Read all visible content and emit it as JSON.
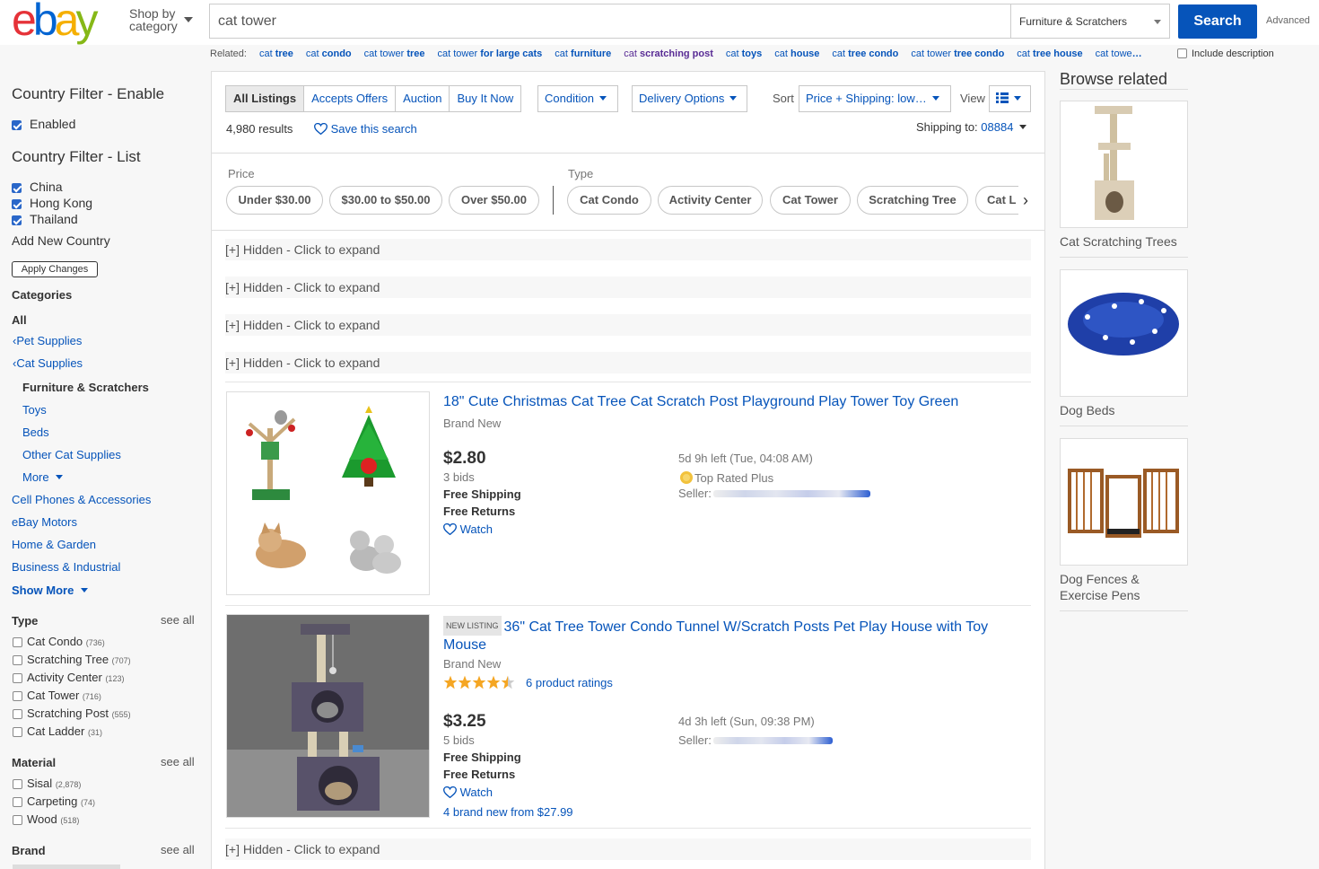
{
  "header": {
    "logo": [
      "e",
      "b",
      "a",
      "y"
    ],
    "logo_colors": [
      "#e53238",
      "#0064d2",
      "#f5af02",
      "#86b817"
    ],
    "shop_by_line1": "Shop by",
    "shop_by_line2": "category",
    "search_value": "cat tower",
    "category_select": "Furniture & Scratchers",
    "search_button": "Search",
    "advanced": "Advanced"
  },
  "related": {
    "label": "Related:",
    "items": [
      {
        "pre": "cat ",
        "bold": "tree"
      },
      {
        "pre": "cat ",
        "bold": "condo"
      },
      {
        "pre": "cat tower ",
        "bold": "tree"
      },
      {
        "pre": "cat tower ",
        "bold": "for large cats"
      },
      {
        "pre": "cat ",
        "bold": "furniture"
      },
      {
        "pre": "cat ",
        "bold": "scratching post"
      },
      {
        "pre": "cat ",
        "bold": "toys"
      },
      {
        "pre": "cat ",
        "bold": "house"
      },
      {
        "pre": "cat ",
        "bold": "tree condo"
      },
      {
        "pre": "cat tower ",
        "bold": "tree condo"
      },
      {
        "pre": "cat ",
        "bold": "tree house"
      },
      {
        "pre": "cat towe",
        "bold": "…"
      }
    ],
    "include_description": "Include description"
  },
  "sidebar": {
    "country_enable_title": "Country Filter - Enable",
    "enabled_label": "Enabled",
    "country_list_title": "Country Filter - List",
    "countries": [
      "China",
      "Hong Kong",
      "Thailand"
    ],
    "add_country": "Add New Country",
    "apply": "Apply Changes",
    "categories_title": "Categories",
    "all": "All",
    "pet_supplies": "Pet Supplies",
    "cat_supplies": "Cat Supplies",
    "current_category": "Furniture & Scratchers",
    "subcats": [
      "Toys",
      "Beds",
      "Other Cat Supplies",
      "More"
    ],
    "other_cats": [
      "Cell Phones & Accessories",
      "eBay Motors",
      "Home & Garden",
      "Business & Industrial"
    ],
    "show_more": "Show More",
    "see_all": "see all",
    "type_title": "Type",
    "types": [
      {
        "label": "Cat Condo",
        "count": "(736)"
      },
      {
        "label": "Scratching Tree",
        "count": "(707)"
      },
      {
        "label": "Activity Center",
        "count": "(123)"
      },
      {
        "label": "Cat Tower",
        "count": "(716)"
      },
      {
        "label": "Scratching Post",
        "count": "(555)"
      },
      {
        "label": "Cat Ladder",
        "count": "(31)"
      }
    ],
    "material_title": "Material",
    "materials": [
      {
        "label": "Sisal",
        "count": "(2,878)"
      },
      {
        "label": "Carpeting",
        "count": "(74)"
      },
      {
        "label": "Wood",
        "count": "(518)"
      }
    ],
    "brand_title": "Brand"
  },
  "results": {
    "tabs": [
      "All Listings",
      "Accepts Offers",
      "Auction",
      "Buy It Now"
    ],
    "condition": "Condition",
    "delivery": "Delivery Options",
    "sort_label": "Sort",
    "sort_value": "Price + Shipping: low…",
    "view_label": "View",
    "count": "4,980 results",
    "save_search": "Save this search",
    "shipping_to_label": "Shipping to:",
    "zip": "08884",
    "price_label": "Price",
    "price_pills": [
      "Under $30.00",
      "$30.00 to $50.00",
      "Over $50.00"
    ],
    "type_label": "Type",
    "type_pills": [
      "Cat Condo",
      "Activity Center",
      "Cat Tower",
      "Scratching Tree",
      "Cat L"
    ],
    "hidden_text": "[+] Hidden - Click to expand"
  },
  "items": [
    {
      "title": "18\" Cute Christmas Cat Tree Cat Scratch Post Playground Play Tower Toy Green",
      "condition": "Brand New",
      "price": "$2.80",
      "bids": "3 bids",
      "shipping": "Free Shipping",
      "returns": "Free Returns",
      "watch": "Watch",
      "time_left": "5d 9h left (Tue, 04:08 AM)",
      "top_rated": "Top Rated Plus",
      "seller_label": "Seller:"
    },
    {
      "badge": "NEW LISTING",
      "title": "36\" Cat Tree Tower Condo Tunnel W/Scratch Posts Pet Play House with Toy Mouse",
      "condition": "Brand New",
      "rating": 4.5,
      "ratings_text": "6 product ratings",
      "price": "$3.25",
      "bids": "5 bids",
      "shipping": "Free Shipping",
      "returns": "Free Returns",
      "watch": "Watch",
      "time_left": "4d 3h left (Sun, 09:38 PM)",
      "seller_label": "Seller:",
      "brand_new_from": "4 brand new from $27.99"
    }
  ],
  "browse_related": {
    "title": "Browse related",
    "items": [
      "Cat Scratching Trees",
      "Dog Beds",
      "Dog Fences & Exercise Pens"
    ]
  }
}
